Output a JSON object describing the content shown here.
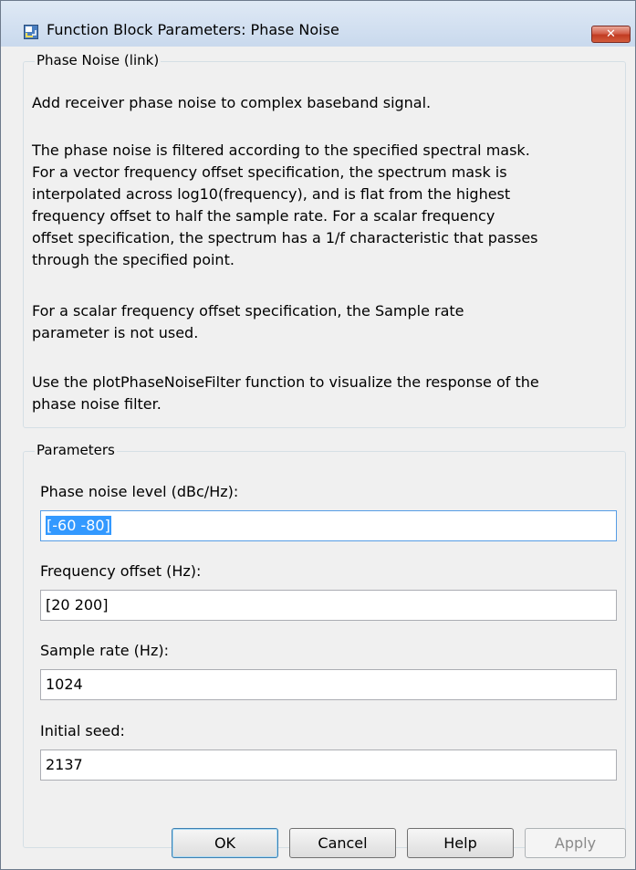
{
  "window": {
    "title": "Function Block Parameters: Phase Noise",
    "close_label": "✕",
    "icon": "simulink-block-icon"
  },
  "description": {
    "legend": "Phase Noise (link)",
    "paragraphs": [
      "Add receiver phase noise to complex baseband signal.",
      "The phase noise is filtered according to the specified spectral mask.\nFor a vector frequency offset specification, the spectrum mask is\ninterpolated across log10(frequency), and is flat from the highest\nfrequency offset to half the sample rate.  For a scalar frequency\noffset specification, the spectrum has a 1/f characteristic that passes\nthrough the specified point.",
      "For a scalar frequency offset specification, the Sample rate\nparameter is not used.",
      "Use the plotPhaseNoiseFilter function to visualize the response of the\nphase noise filter."
    ]
  },
  "parameters": {
    "legend": "Parameters",
    "fields": [
      {
        "label": "Phase noise level (dBc/Hz):",
        "value": "[-60 -80]"
      },
      {
        "label": "Frequency offset (Hz):",
        "value": "[20 200]"
      },
      {
        "label": "Sample rate (Hz):",
        "value": "1024"
      },
      {
        "label": "Initial seed:",
        "value": "2137"
      }
    ]
  },
  "buttons": {
    "ok": "OK",
    "cancel": "Cancel",
    "help": "Help",
    "apply": "Apply"
  }
}
